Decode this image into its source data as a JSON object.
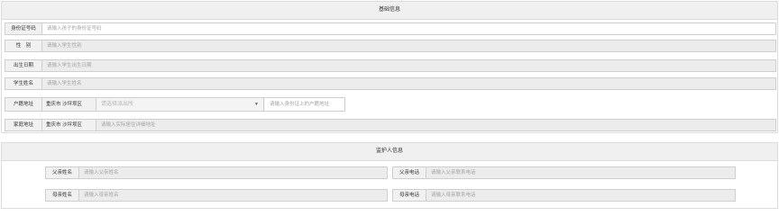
{
  "basic": {
    "title": "基础信息",
    "id_label": "身份证号码",
    "id_placeholder": "请输入孩子的身份证号码",
    "gender_label": "性　别",
    "gender_placeholder": "请输入学生性别",
    "birth_label": "出生日期",
    "birth_placeholder": "请输入学生出生日期",
    "name_label": "学生姓名",
    "name_placeholder": "请输入学生姓名",
    "hukou_label": "户籍地址",
    "hukou_city": "重庆市 沙坪坝区",
    "hukou_select": "请选择派出所",
    "hukou_placeholder": "请输入身份证上的户籍地址",
    "home_label": "家庭地址",
    "home_city": "重庆市 沙坪坝区",
    "home_placeholder": "请输入实际居住详细地址"
  },
  "guardian": {
    "title": "监护人信息",
    "father_name_label": "父亲姓名",
    "father_name_placeholder": "请输入父亲姓名",
    "father_phone_label": "父亲电话",
    "father_phone_placeholder": "请输入父亲联系电话",
    "mother_name_label": "母亲姓名",
    "mother_name_placeholder": "请输入母亲姓名",
    "mother_phone_label": "母亲电话",
    "mother_phone_placeholder": "请输入母亲联系电话"
  }
}
